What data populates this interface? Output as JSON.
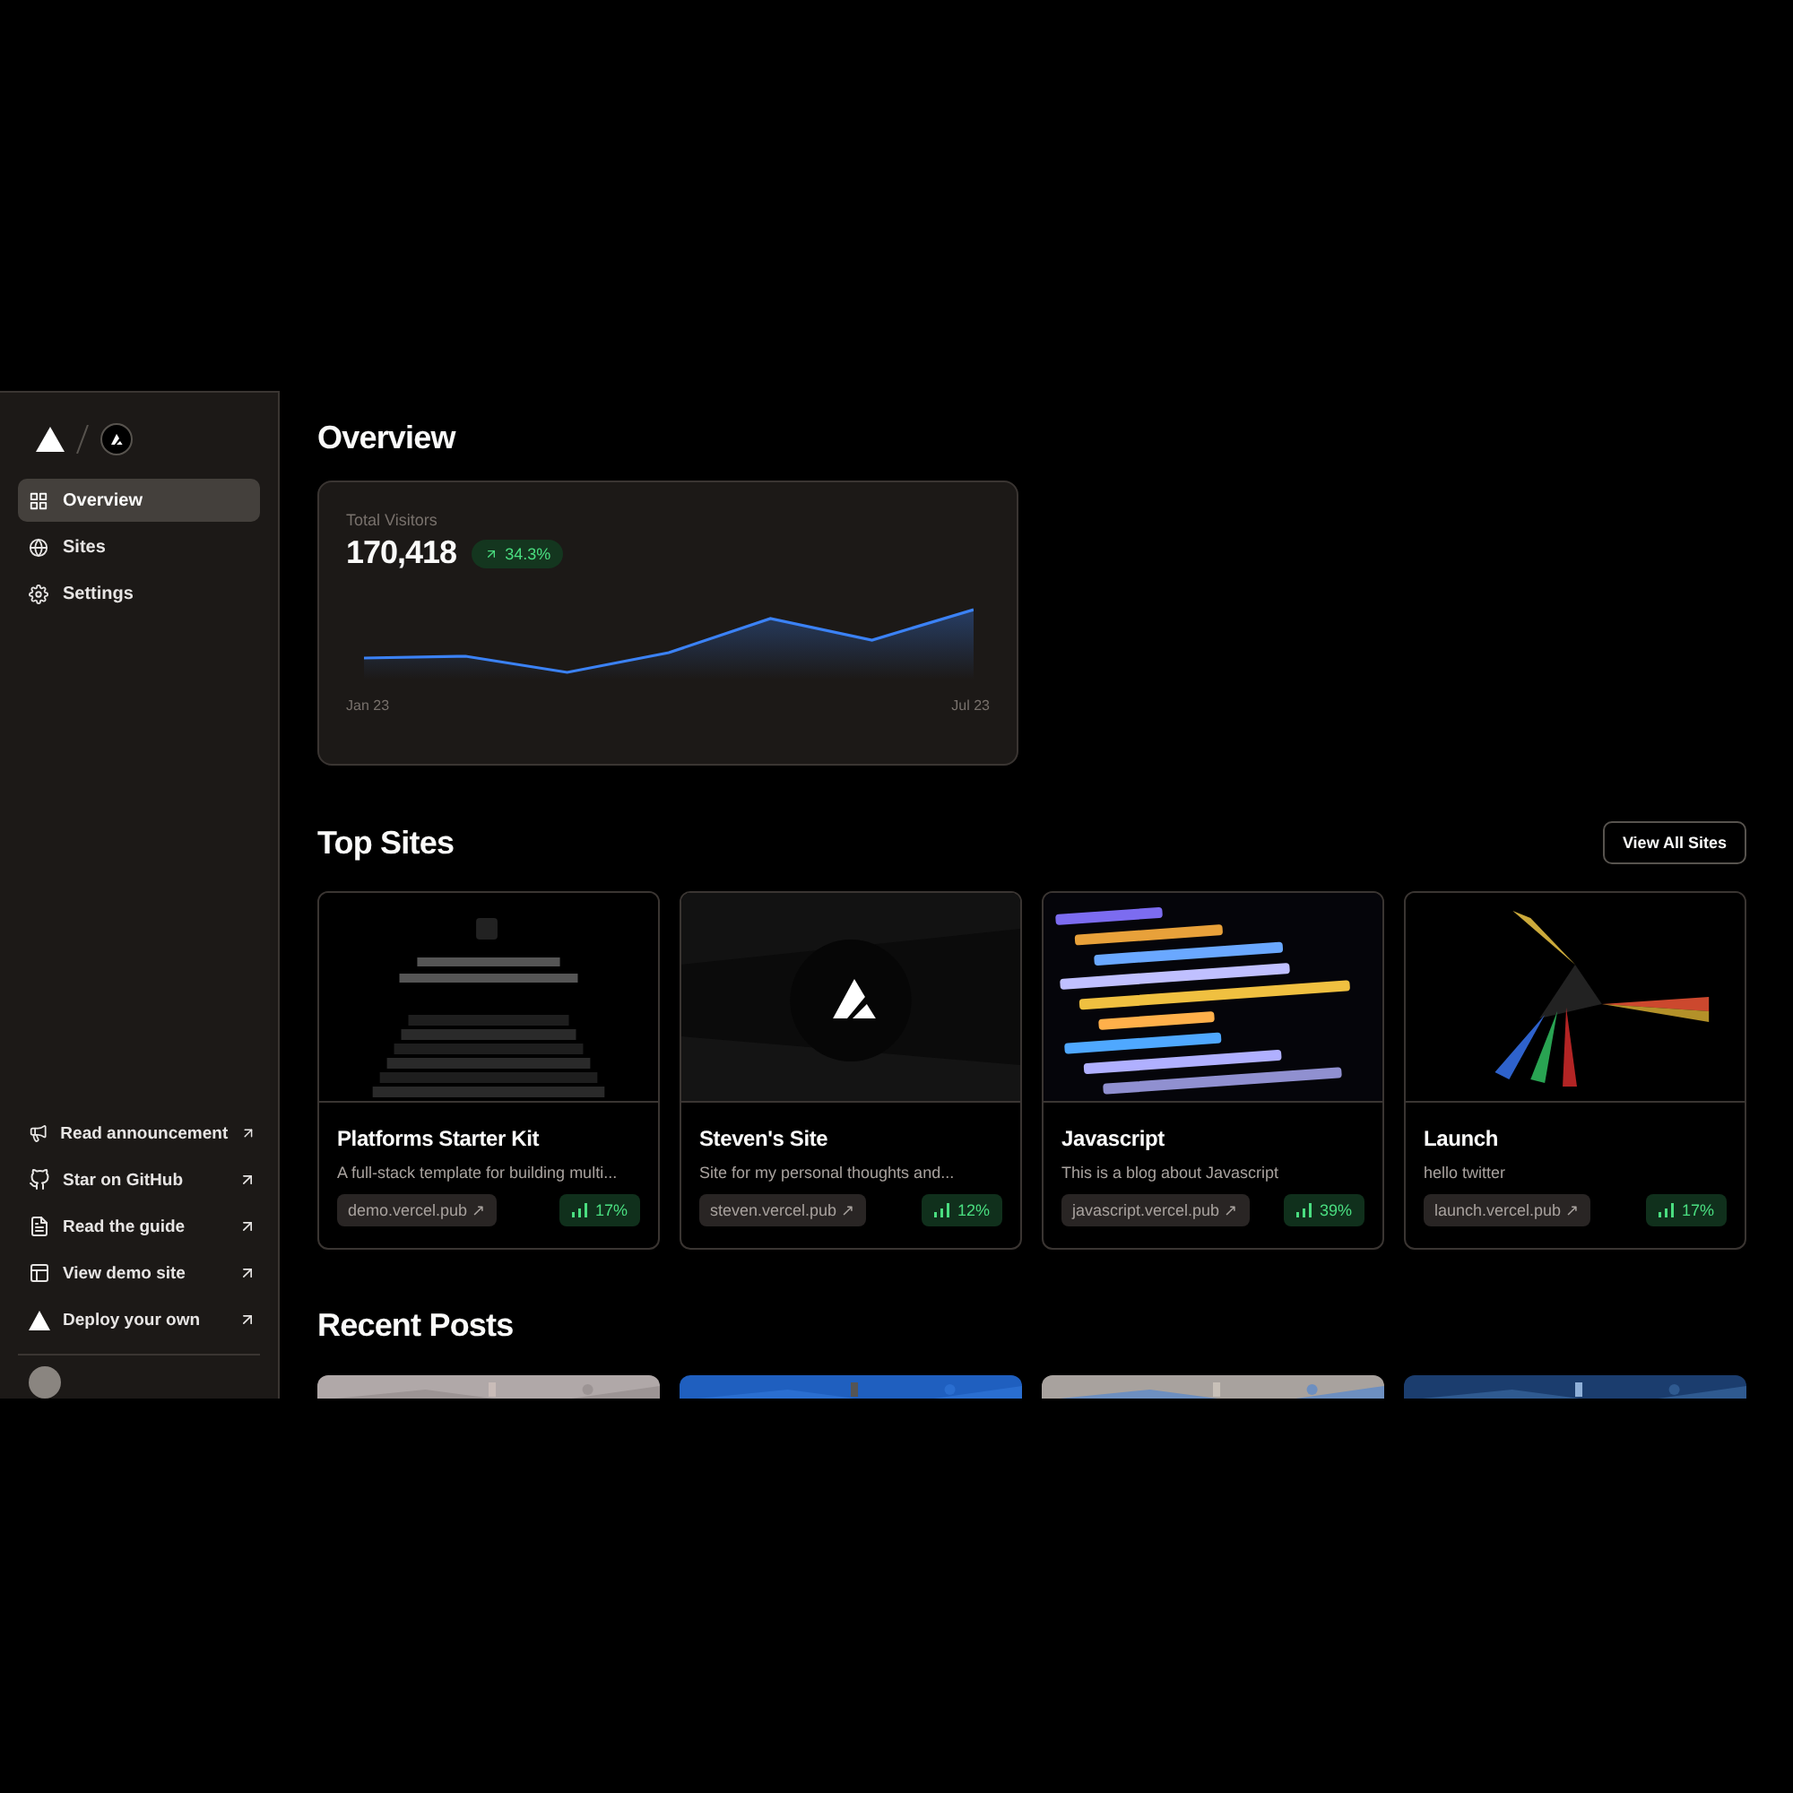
{
  "sidebar": {
    "nav": [
      {
        "label": "Overview",
        "selected": true
      },
      {
        "label": "Sites",
        "selected": false
      },
      {
        "label": "Settings",
        "selected": false
      }
    ],
    "links": [
      "Read announcement",
      "Star on GitHub",
      "Read the guide",
      "View demo site",
      "Deploy your own"
    ]
  },
  "overview": {
    "title": "Overview",
    "label": "Total Visitors",
    "value": "170,418",
    "change": "34.3%",
    "start": "Jan 23",
    "end": "Jul 23"
  },
  "top_sites": {
    "title": "Top Sites",
    "button": "View All Sites",
    "sites": [
      {
        "name": "Platforms Starter Kit",
        "description": "A full-stack template for building multi...",
        "url": "demo.vercel.pub ↗",
        "stat": "17%"
      },
      {
        "name": "Steven's Site",
        "description": "Site for my personal thoughts and...",
        "url": "steven.vercel.pub ↗",
        "stat": "12%"
      },
      {
        "name": "Javascript",
        "description": "This is a blog about Javascript",
        "url": "javascript.vercel.pub ↗",
        "stat": "39%"
      },
      {
        "name": "Launch",
        "description": "hello twitter",
        "url": "launch.vercel.pub ↗",
        "stat": "17%"
      }
    ]
  },
  "recent_posts": {
    "title": "Recent Posts"
  }
}
